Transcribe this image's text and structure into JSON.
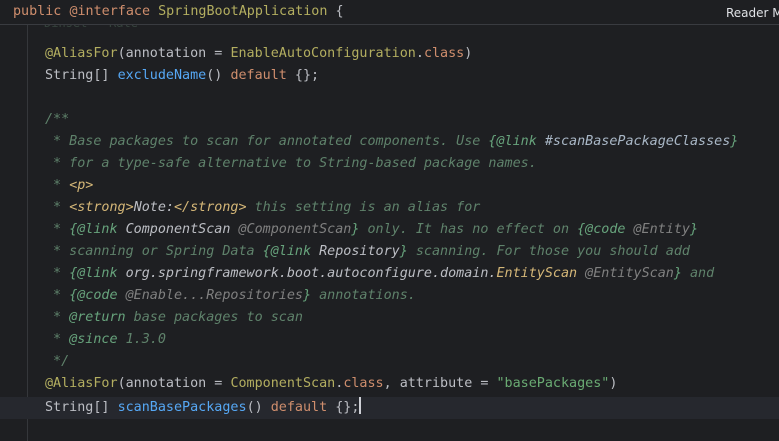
{
  "sticky_header": {
    "kw_public": "public",
    "kw_interface": "@interface",
    "class_name": "SpringBootApplication",
    "brace": " {"
  },
  "reader_mode_label": "Reader M",
  "cutoff_text": "Dinset   Rate",
  "lines": {
    "l1": {
      "annotation": "@AliasFor",
      "open": "(annotation = ",
      "target": "EnableAutoConfiguration",
      "dot": ".",
      "class_kw": "class",
      "close": ")"
    },
    "l2": {
      "type": "String[] ",
      "method": "excludeName",
      "parens": "() ",
      "default_kw": "default",
      "rest": " {};"
    },
    "l4": {
      "open": "/**"
    },
    "l5": {
      "text": " * Base packages to scan for annotated components. Use ",
      "link_open": "{@link ",
      "ref": "#scanBasePackageClasses",
      "link_close": "}"
    },
    "l6": {
      "text": " * for a type-safe alternative to String-based package names."
    },
    "l7": {
      "star": " * ",
      "tag": "<p>"
    },
    "l8": {
      "star": " * ",
      "tag_open": "<strong>",
      "note": "Note:",
      "tag_close": "</strong>",
      "rest": " this setting is an alias for"
    },
    "l9": {
      "star": " * ",
      "link1_open": "{@link ",
      "link1_ref": "ComponentScan",
      "link1_label": " @ComponentScan",
      "link1_close": "}",
      "mid": " only. It has no effect on ",
      "code_open": "{@code ",
      "code_ref": "@Entity",
      "code_close": "}"
    },
    "l10": {
      "text": " * scanning or Spring Data ",
      "link_open": "{@link ",
      "link_ref": "Repository",
      "link_close": "}",
      "rest": " scanning. For those you should add"
    },
    "l11": {
      "star": " * ",
      "link_open": "{@link ",
      "pkg": "org.springframework.boot.autoconfigure.domain.",
      "cls": "EntityScan",
      "label": " @EntityScan",
      "link_close": "}",
      "rest": " and"
    },
    "l12": {
      "star": " * ",
      "code_open": "{@code ",
      "code_ref": "@Enable...Repositories",
      "code_close": "}",
      "rest": " annotations."
    },
    "l13": {
      "star": " * ",
      "tag": "@return",
      "rest": " base packages to scan"
    },
    "l14": {
      "star": " * ",
      "tag": "@since",
      "rest": " 1.3.0"
    },
    "l15": {
      "close": " */"
    },
    "l16": {
      "annotation": "@AliasFor",
      "open": "(annotation = ",
      "target": "ComponentScan",
      "dot": ".",
      "class_kw": "class",
      "mid": ", attribute = ",
      "str": "\"basePackages\"",
      "close": ")"
    },
    "l17": {
      "type": "String[] ",
      "method": "scanBasePackages",
      "parens": "() ",
      "default_kw": "default",
      "rest": " {};"
    }
  },
  "colors": {
    "background": "#1e1f22",
    "current_line": "#26282e",
    "keyword": "#cf8e6d",
    "annotation": "#b3ae60",
    "method": "#56a8f5",
    "string": "#6aab73",
    "javadoc": "#5f826b",
    "javadoc_tag": "#67a37c",
    "html_tag": "#d5b778",
    "text": "#bcbec4"
  }
}
